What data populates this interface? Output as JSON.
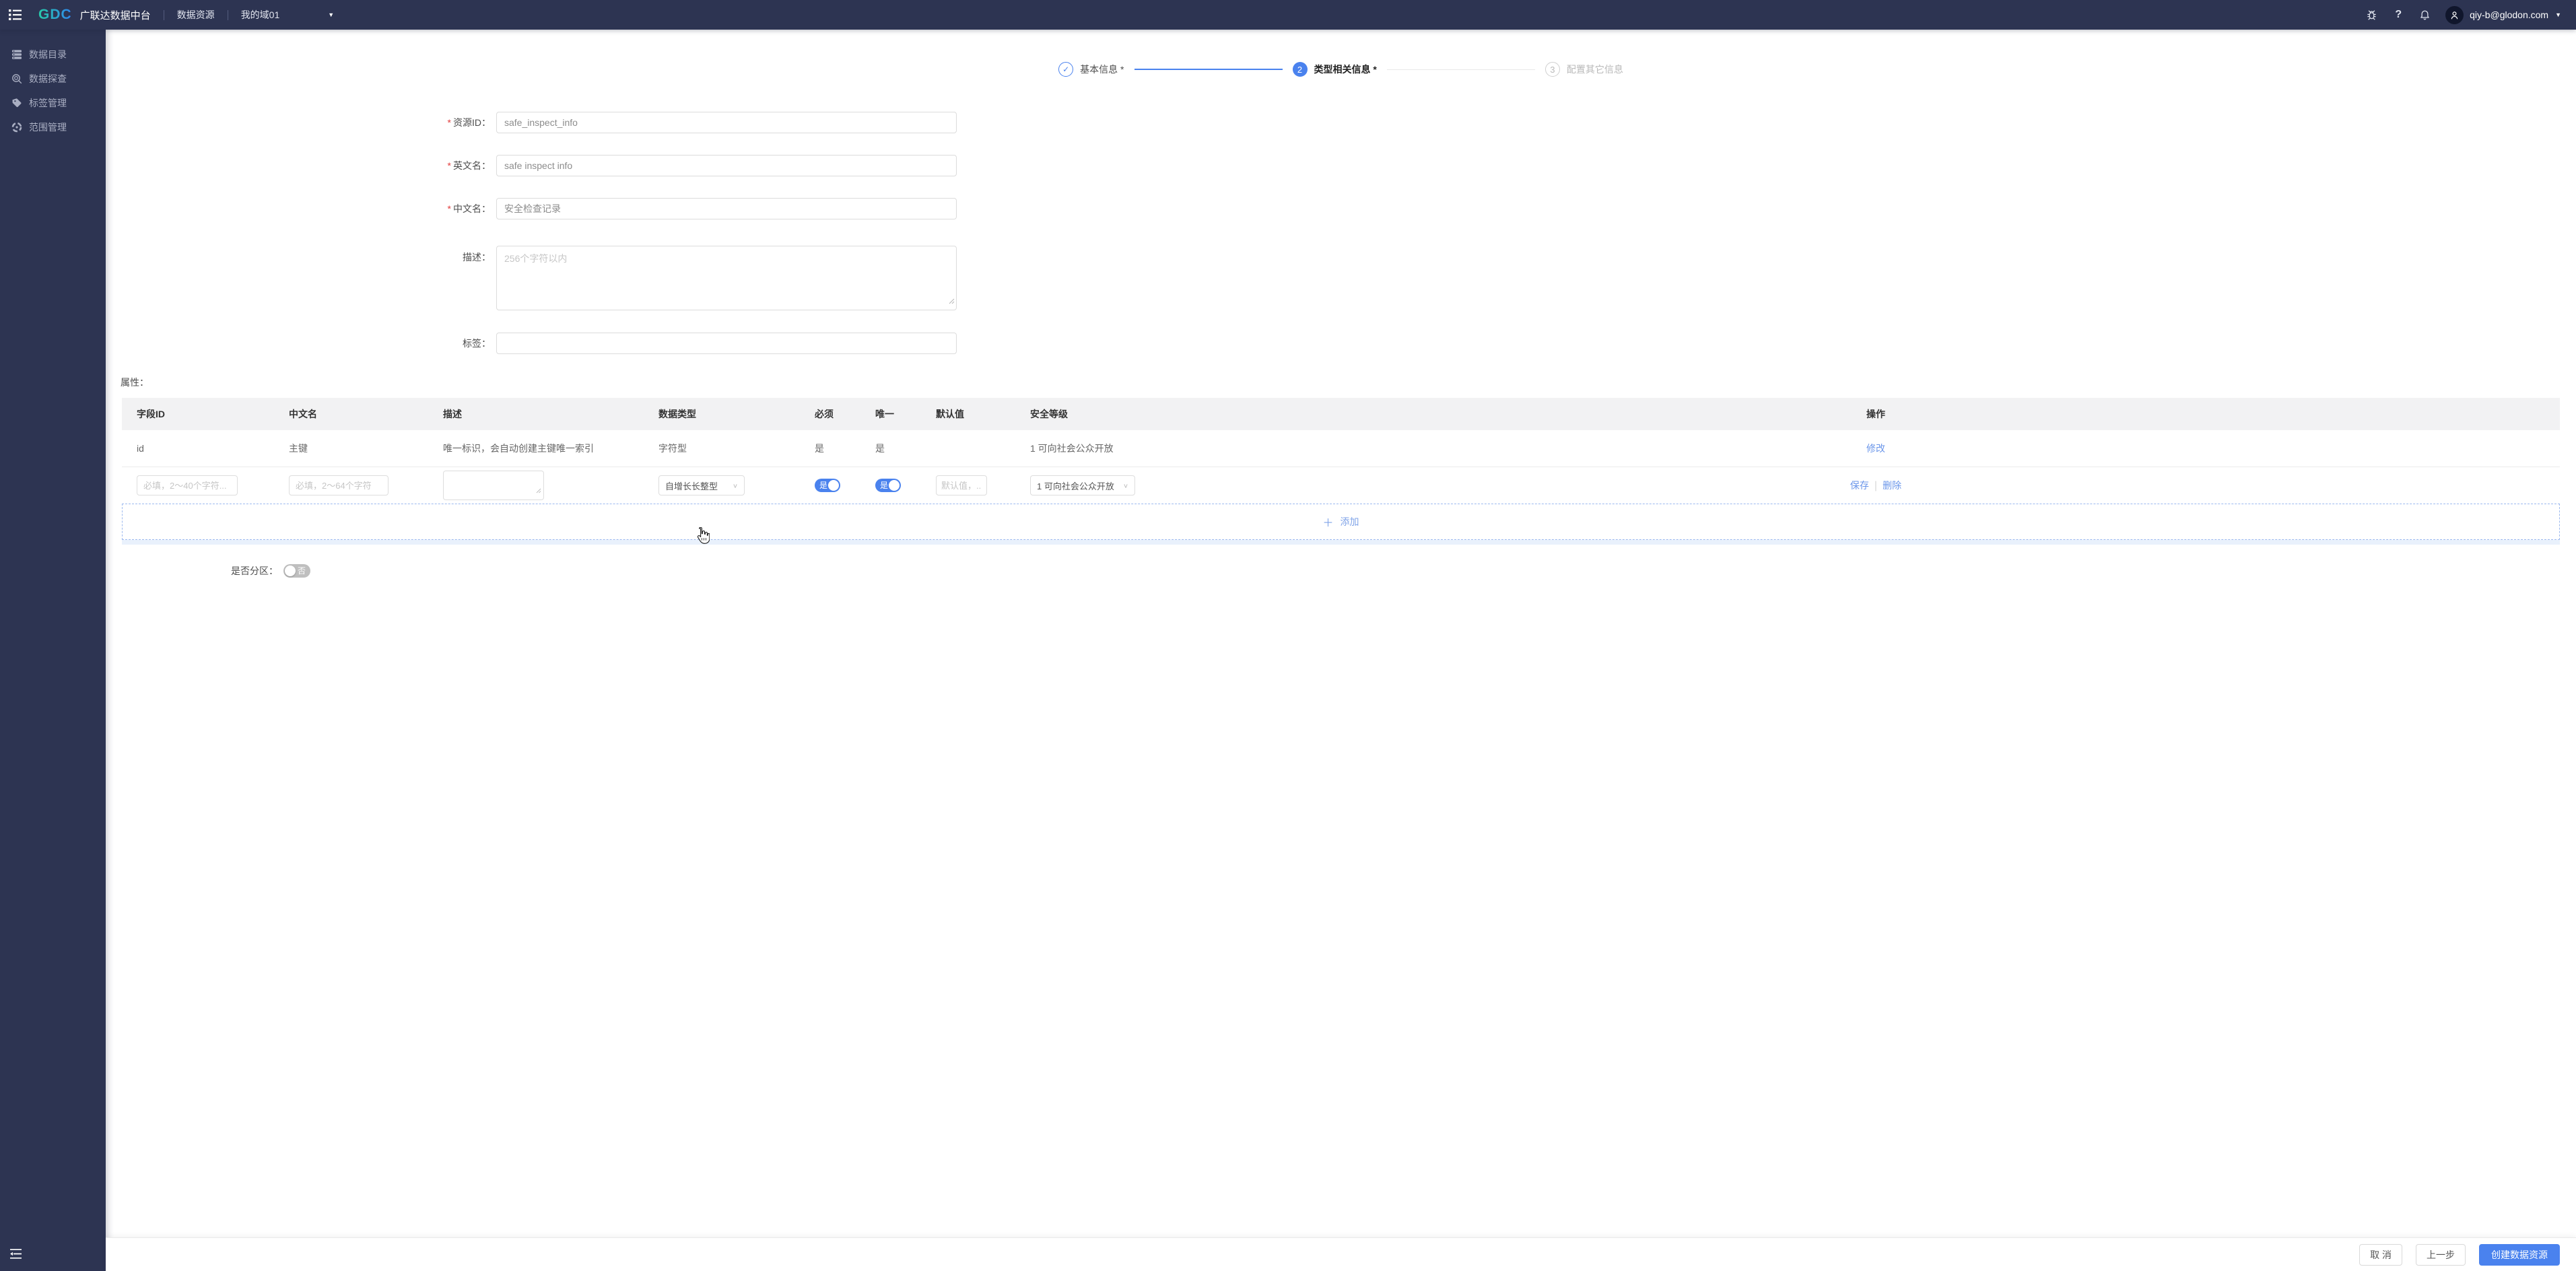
{
  "colors": {
    "navy": "#2d3452",
    "accent": "#4a82ee",
    "link": "#6b96ea",
    "table_header_bg": "#f2f2f3"
  },
  "topbar": {
    "logo": "GDC",
    "title": "广联达数据中台",
    "nav_item": "数据资源",
    "domain": "我的域01",
    "email": "qiy-b@glodon.com"
  },
  "sidebar": {
    "items": [
      {
        "label": "数据目录",
        "icon": "database-icon"
      },
      {
        "label": "数据探查",
        "icon": "explore-icon"
      },
      {
        "label": "标签管理",
        "icon": "tag-icon"
      },
      {
        "label": "范围管理",
        "icon": "scope-icon"
      }
    ]
  },
  "stepper": {
    "step1": {
      "check": "✓",
      "label": "基本信息 *"
    },
    "step2": {
      "num": "2",
      "label": "类型相关信息 *"
    },
    "step3": {
      "num": "3",
      "label": "配置其它信息"
    }
  },
  "form": {
    "resource_id": {
      "label": "资源ID：",
      "value": "safe_inspect_info"
    },
    "en_name": {
      "label": "英文名：",
      "value": "safe inspect info"
    },
    "cn_name": {
      "label": "中文名：",
      "value": "安全检查记录"
    },
    "description": {
      "label": "描述：",
      "placeholder": "256个字符以内"
    },
    "tags": {
      "label": "标签："
    }
  },
  "attrs": {
    "section_label": "属性：",
    "headers": [
      "字段ID",
      "中文名",
      "描述",
      "数据类型",
      "必须",
      "唯一",
      "默认值",
      "安全等级",
      "操作"
    ],
    "row1": {
      "field_id": "id",
      "cn_name": "主键",
      "description": "唯一标识，会自动创建主键唯一索引",
      "data_type": "字符型",
      "required": "是",
      "unique": "是",
      "default_value": "",
      "security_level": "1 可向社会公众开放",
      "action": "修改"
    },
    "edit_row": {
      "field_id_placeholder": "必填，2～40个字符...",
      "cn_name_placeholder": "必填，2～64个字符",
      "data_type": "自增长长整型",
      "required_toggle": "是",
      "unique_toggle": "是",
      "default_placeholder": "默认值，...",
      "security_level": "1 可向社会公众开放",
      "save": "保存",
      "delete": "删除"
    },
    "add_button": "添加",
    "plus": "＋"
  },
  "partition": {
    "label": "是否分区：",
    "value": "否"
  },
  "footer": {
    "cancel": "取 消",
    "previous": "上一步",
    "create": "创建数据资源"
  }
}
